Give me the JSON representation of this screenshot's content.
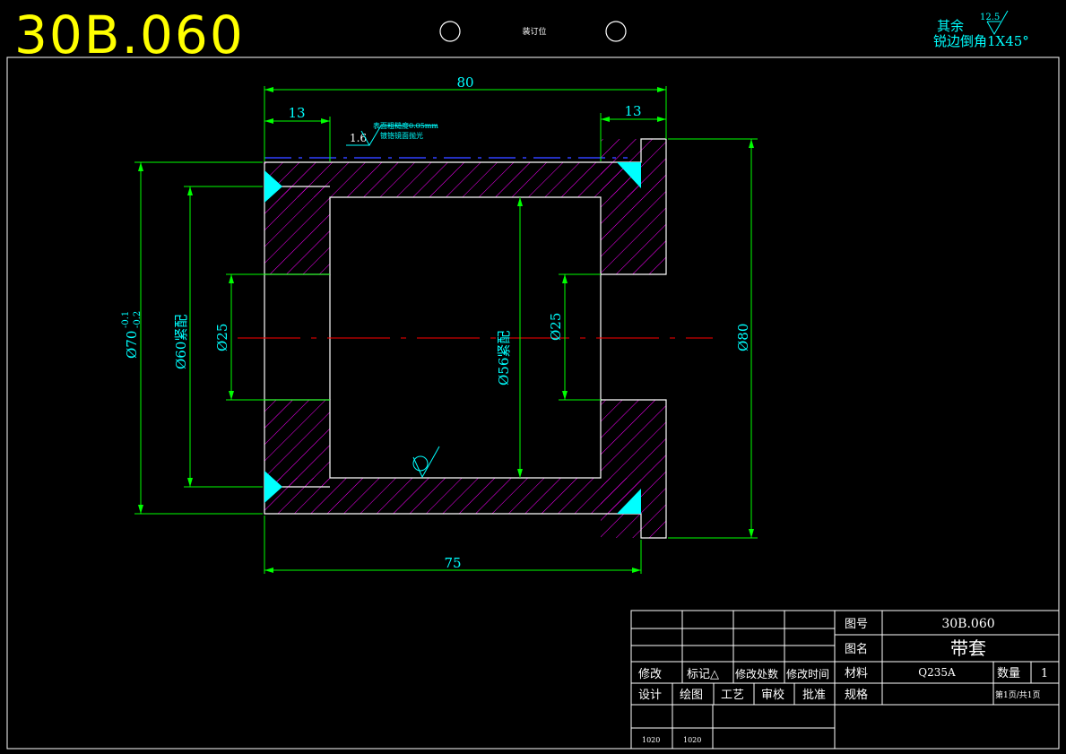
{
  "header": {
    "drawing_code": "30B.060",
    "binding_label": "装订位",
    "roughness_note_label": "其余",
    "roughness_note_value": "12.5",
    "edge_note": "锐边倒角1X45°"
  },
  "dimensions": {
    "overall_length": "80",
    "left_flange_width": "13",
    "right_flange_width": "13",
    "bottom_length": "75",
    "outer_diameter_left": "Ø70",
    "outer_tolerance_upper": "-0.1",
    "outer_tolerance_lower": "-0.2",
    "press_fit_60": "Ø60紧配",
    "bore_left": "Ø25",
    "press_fit_56": "Ø56紧配",
    "bore_right": "Ø25",
    "flange_diameter": "Ø80"
  },
  "annotations": {
    "surface_roughness": "1.6",
    "surface_note_line1": "表面粗糙度0.05mm",
    "surface_note_line2": "镀铬镜面抛光"
  },
  "title_block": {
    "change_header": [
      "修改",
      "标记△",
      "修改处数",
      "修改时间"
    ],
    "sign_header": [
      "设计",
      "绘图",
      "工艺",
      "审校",
      "批准"
    ],
    "dates": [
      "1020",
      "1020"
    ],
    "drawing_no_label": "图号",
    "drawing_no": "30B.060",
    "drawing_name_label": "图名",
    "drawing_name": "带套",
    "material_label": "材料",
    "material": "Q235A",
    "quantity_label": "数量",
    "quantity": "1",
    "spec_label": "规格",
    "page_info": "第1页/共1页"
  },
  "colors": {
    "outline": "#ffffff",
    "dimension": "#00ff00",
    "dimension_text": "#00ffff",
    "hatch": "#ff00ff",
    "centerline": "#ff0000",
    "title_code": "#ffff00",
    "coating": "#3040ff"
  }
}
